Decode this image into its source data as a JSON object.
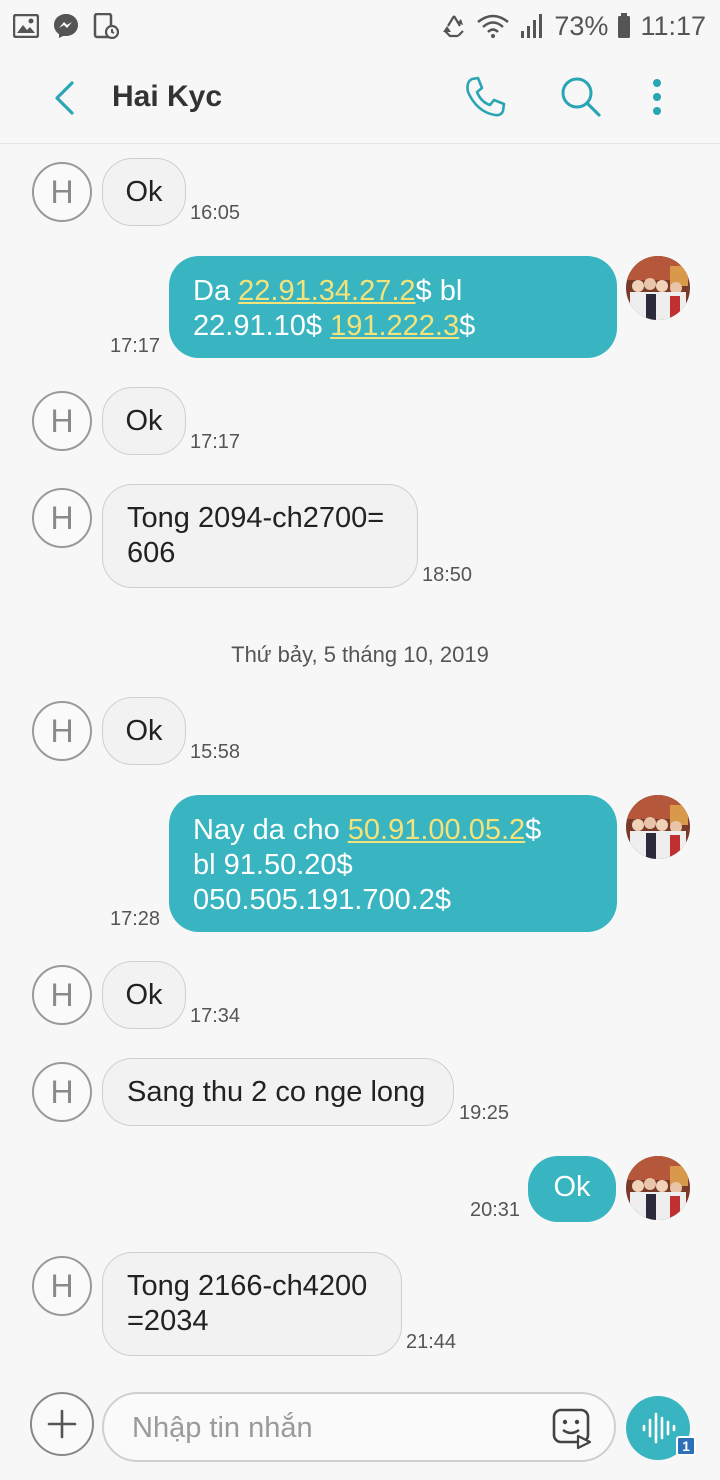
{
  "status_bar": {
    "battery_percent": "73%",
    "time": "11:17",
    "icons": [
      "gallery-icon",
      "messenger-icon",
      "screen-record-icon",
      "recycle-icon",
      "wifi-icon",
      "signal-icon",
      "battery-icon"
    ]
  },
  "header": {
    "title": "Hai Kyc",
    "icons": [
      "back-arrow-icon",
      "phone-icon",
      "search-icon",
      "more-vert-icon"
    ]
  },
  "contact": {
    "initial": "H"
  },
  "messages": [
    {
      "dir": "in",
      "text": "Ok",
      "time": "16:05"
    },
    {
      "dir": "out",
      "parts": [
        "Da ",
        "22.91.34.27.2",
        "$ bl",
        "22.91.10$ ",
        "191.222.3",
        "$"
      ],
      "time": "17:17"
    },
    {
      "dir": "in",
      "text": "Ok",
      "time": "17:17"
    },
    {
      "dir": "in",
      "lines": [
        "Tong 2094-ch2700=",
        "606"
      ],
      "time": "18:50"
    },
    {
      "dir": "in",
      "text": "Ok",
      "time": "15:58"
    },
    {
      "dir": "out",
      "parts": [
        "Nay da cho ",
        "50.91.00.05.2",
        "$",
        "bl 91.50.20$",
        "050.505.191.700.2$"
      ],
      "time": "17:28"
    },
    {
      "dir": "in",
      "text": "Ok",
      "time": "17:34"
    },
    {
      "dir": "in",
      "text": "Sang thu 2 co nge long",
      "time": "19:25"
    },
    {
      "dir": "out",
      "text": "Ok",
      "time": "20:31"
    },
    {
      "dir": "in",
      "lines": [
        "Tong 2166-ch4200",
        "=2034"
      ],
      "time": "21:44"
    }
  ],
  "date_separator": "Thứ bảy, 5 tháng 10, 2019",
  "composer": {
    "placeholder": "Nhập tin nhắn",
    "voice_badge": "1",
    "icons": [
      "plus-icon",
      "sticker-icon",
      "voice-wave-icon"
    ]
  },
  "colors": {
    "accent": "#38b5c0",
    "link": "#f4e27a",
    "background": "#f7f7f7"
  }
}
